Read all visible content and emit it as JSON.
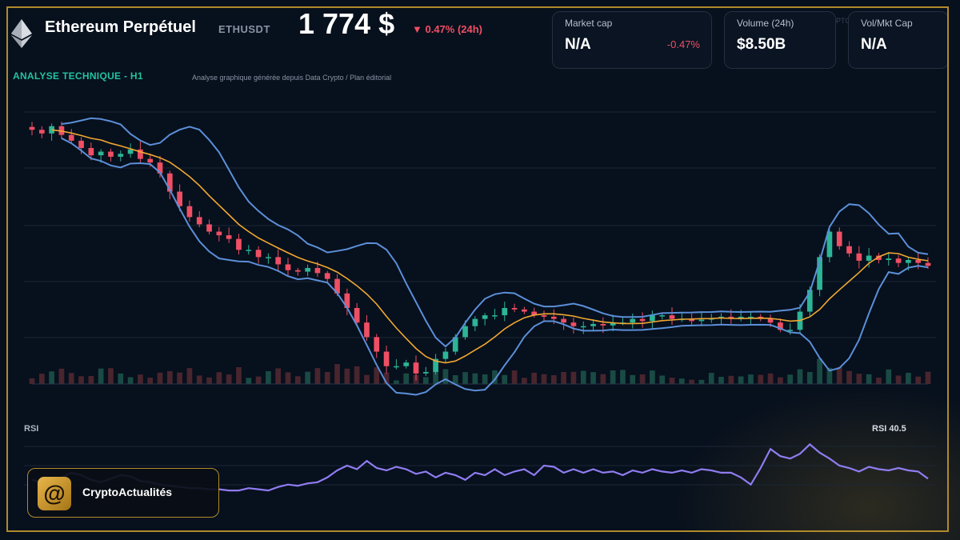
{
  "header": {
    "title": "Ethereum Perpétuel",
    "symbol": "ETHUSDT",
    "price": "1 774 $",
    "change": "▼ 0.47% (24h)"
  },
  "stats": [
    {
      "label": "Market cap",
      "value": "N/A",
      "sub": "-0.47%"
    },
    {
      "label": "Volume (24h)",
      "value": "$8.50B",
      "sub": ""
    },
    {
      "label": "Vol/Mkt Cap",
      "value": "N/A",
      "sub": ""
    }
  ],
  "ghost_text": "PTC",
  "section": {
    "title": "ANALYSE TECHNIQUE - H1",
    "subtitle": "Analyse graphique générée depuis Data Crypto / Plan éditorial"
  },
  "rsi": {
    "label": "RSI",
    "value_label": "RSI 40.5"
  },
  "brand": {
    "name": "CryptoActualités",
    "logo_glyph": "@"
  },
  "colors": {
    "background": "#07101d",
    "frame": "#b08a2c",
    "accent_teal": "#22c3a0",
    "down_red": "#ef4f64",
    "up_green": "#2cb596",
    "bollinger": "#5b8fd8",
    "moving_average": "#f0a830",
    "rsi_line": "#8f7cf0"
  },
  "chart_data": {
    "type": "line",
    "title": "ANALYSE TECHNIQUE - H1",
    "series": [
      {
        "values": [
          2045,
          2040,
          2050,
          2038,
          2030,
          2020,
          2010,
          2015,
          2008,
          2012,
          2018,
          2005,
          2000,
          1985,
          1960,
          1940,
          1925,
          1915,
          1905,
          1900,
          1895,
          1880,
          1880,
          1870,
          1870,
          1860,
          1852,
          1850,
          1855,
          1848,
          1840,
          1820,
          1800,
          1780,
          1760,
          1740,
          1720,
          1720,
          1725,
          1710,
          1712,
          1730,
          1740,
          1760,
          1775,
          1785,
          1790,
          1790,
          1800,
          1798,
          1795,
          1790,
          1788,
          1785,
          1780,
          1775,
          1775,
          1778,
          1776,
          1780,
          1780,
          1785,
          1782,
          1790,
          1790,
          1785,
          1785,
          1782,
          1784,
          1786,
          1788,
          1786,
          1788,
          1788,
          1786,
          1780,
          1770,
          1770,
          1795,
          1825,
          1870,
          1905,
          1885,
          1875,
          1865,
          1872,
          1866,
          1868,
          1862,
          1866,
          1862,
          1858
        ]
      }
    ],
    "rsi": [
      40,
      38,
      36,
      42,
      46,
      44,
      40,
      38,
      41,
      44,
      43,
      39,
      38,
      36,
      35,
      34,
      33,
      33,
      32,
      32,
      31,
      31,
      33,
      32,
      31,
      34,
      36,
      35,
      37,
      38,
      42,
      48,
      52,
      49,
      56,
      50,
      48,
      51,
      49,
      45,
      47,
      42,
      46,
      44,
      40,
      46,
      44,
      49,
      44,
      47,
      49,
      44,
      52,
      51,
      46,
      49,
      46,
      49,
      46,
      47,
      44,
      48,
      46,
      49,
      47,
      46,
      48,
      46,
      49,
      48,
      46,
      46,
      42,
      36,
      50,
      66,
      60,
      58,
      62,
      70,
      63,
      58,
      52,
      50,
      47,
      51,
      49,
      48,
      50,
      48,
      47,
      41
    ]
  }
}
